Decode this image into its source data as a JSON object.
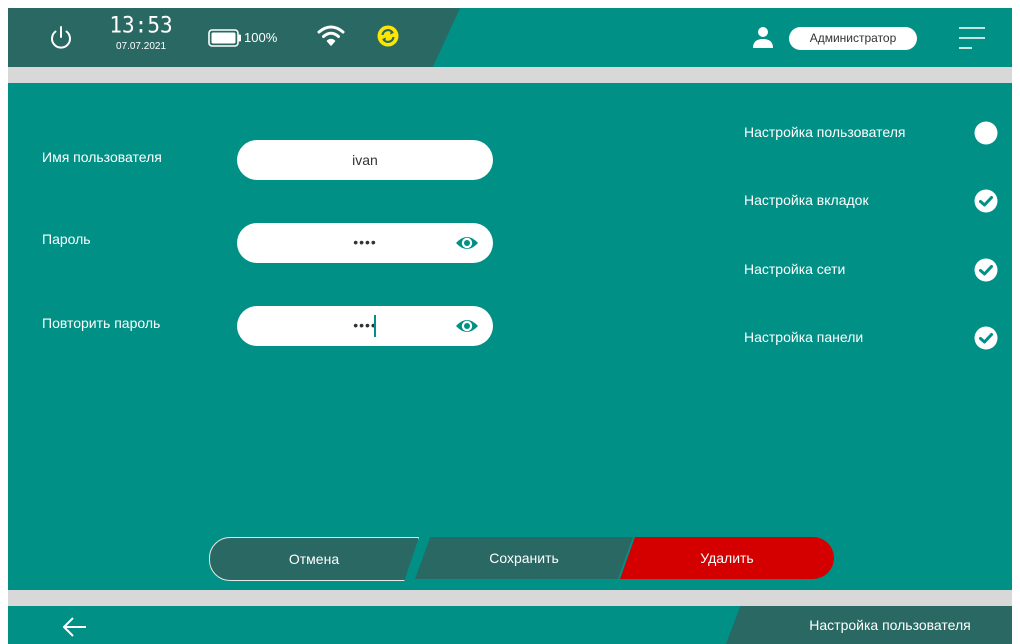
{
  "statusbar": {
    "time": "13:53",
    "date": "07.07.2021",
    "battery_percent": "100%",
    "user_role": "Администратор",
    "icons": [
      "power-icon",
      "battery-icon",
      "wifi-icon",
      "sync-icon",
      "user-icon",
      "menu-icon"
    ],
    "sync_color": "#ffe600"
  },
  "form": {
    "username_label": "Имя пользователя",
    "username_value": "ivan",
    "password_label": "Пароль",
    "password_value": "••••",
    "repeat_password_label": "Повторить пароль",
    "repeat_password_value": "••••"
  },
  "permissions": [
    {
      "label": "Настройка пользователя",
      "checked": false
    },
    {
      "label": "Настройка вкладок",
      "checked": true
    },
    {
      "label": "Настройка сети",
      "checked": true
    },
    {
      "label": "Настройка панели",
      "checked": true
    }
  ],
  "buttons": {
    "cancel": "Отмена",
    "save": "Сохранить",
    "delete": "Удалить"
  },
  "footer": {
    "title": "Настройка пользователя"
  },
  "colors": {
    "teal": "#009086",
    "dark_teal": "#2a6863",
    "delete_red": "#d40000"
  }
}
